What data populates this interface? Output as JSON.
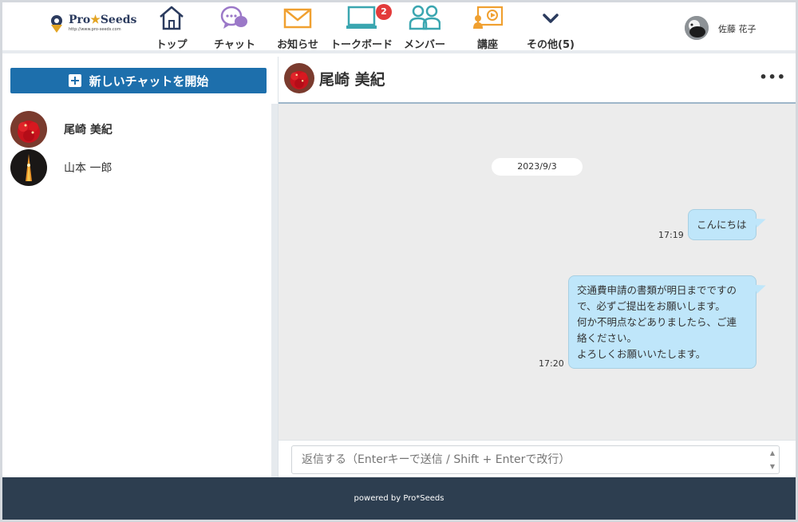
{
  "header": {
    "logo": {
      "brand_a": "Pro",
      "brand_star": "★",
      "brand_b": "Seeds",
      "url": "http://www.pro-seeds.com"
    },
    "nav": [
      {
        "label": "トップ",
        "icon": "home-icon"
      },
      {
        "label": "チャット",
        "icon": "chat-icon"
      },
      {
        "label": "お知らせ",
        "icon": "envelope-icon"
      },
      {
        "label": "トークボード",
        "icon": "laptop-icon",
        "badge": "2"
      },
      {
        "label": "メンバー",
        "icon": "members-icon"
      },
      {
        "label": "講座",
        "icon": "course-icon"
      },
      {
        "label": "その他(5)",
        "icon": "chevron-down-icon"
      }
    ],
    "user_name": "佐藤 花子"
  },
  "sidebar": {
    "new_chat_label": "新しいチャットを開始",
    "contacts": [
      {
        "name": "尾崎 美紀",
        "active": true
      },
      {
        "name": "山本 一郎",
        "active": false
      }
    ]
  },
  "chat": {
    "title": "尾崎 美紀",
    "more": "•••",
    "date": "2023/9/3",
    "messages": [
      {
        "time": "17:19",
        "lines": [
          "こんにちは"
        ]
      },
      {
        "time": "17:20",
        "lines": [
          "交通費申請の書類が明日までですの",
          "で、必ずご提出をお願いします。",
          "何か不明点などありましたら、ご連",
          "絡ください。",
          "よろしくお願いいたします。"
        ]
      }
    ],
    "reply_placeholder": "返信する（Enterキーで送信 / Shift + Enterで改行）"
  },
  "footer": {
    "text": "powered by Pro*Seeds"
  },
  "colors": {
    "primary": "#1d6fac",
    "bubble": "#bfe6fa",
    "footer": "#2d3e50",
    "badge": "#e33b3b",
    "icon_teal": "#3aa6b0",
    "icon_orange": "#f0a030",
    "icon_purple": "#9b78c8"
  }
}
